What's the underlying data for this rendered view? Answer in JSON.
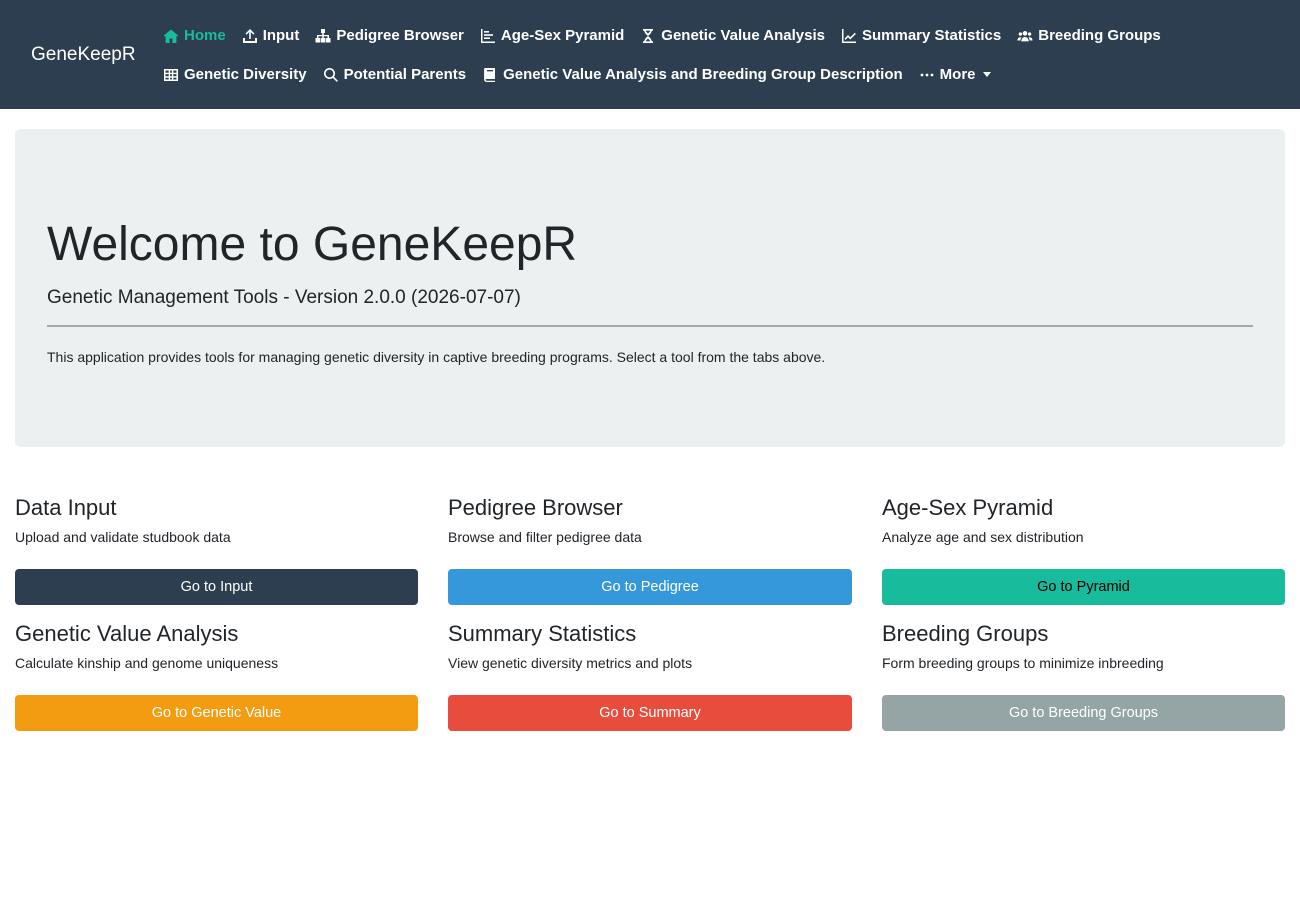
{
  "app": {
    "brand": "GeneKeepR"
  },
  "nav": {
    "items": [
      {
        "label": "Home",
        "icon": "home-icon"
      },
      {
        "label": "Input",
        "icon": "upload-icon"
      },
      {
        "label": "Pedigree Browser",
        "icon": "sitemap-icon"
      },
      {
        "label": "Age-Sex Pyramid",
        "icon": "bar-chart-icon"
      },
      {
        "label": "Genetic Value Analysis",
        "icon": "dna-icon"
      },
      {
        "label": "Summary Statistics",
        "icon": "line-chart-icon"
      },
      {
        "label": "Breeding Groups",
        "icon": "users-icon"
      },
      {
        "label": "Genetic Diversity",
        "icon": "table-icon"
      },
      {
        "label": "Potential Parents",
        "icon": "search-icon"
      },
      {
        "label": "Genetic Value Analysis and Breeding Group Description",
        "icon": "book-icon"
      },
      {
        "label": "More",
        "icon": "ellipsis-icon"
      }
    ],
    "active": "Home"
  },
  "hero": {
    "title": "Welcome to GeneKeepR",
    "subtitle": "Genetic Management Tools - Version 2.0.0 (2026-07-07)",
    "description": "This application provides tools for managing genetic diversity in captive breeding programs. Select a tool from the tabs above."
  },
  "cards": [
    {
      "title": "Data Input",
      "description": "Upload and validate studbook data",
      "button": "Go to Input",
      "color": "#2c3e50"
    },
    {
      "title": "Pedigree Browser",
      "description": "Browse and filter pedigree data",
      "button": "Go to Pedigree",
      "color": "#3498db"
    },
    {
      "title": "Age-Sex Pyramid",
      "description": "Analyze age and sex distribution",
      "button": "Go to Pyramid",
      "color": "#18bc9c"
    },
    {
      "title": "Genetic Value Analysis",
      "description": "Calculate kinship and genome uniqueness",
      "button": "Go to Genetic Value",
      "color": "#f39c12"
    },
    {
      "title": "Summary Statistics",
      "description": "View genetic diversity metrics and plots",
      "button": "Go to Summary",
      "color": "#e74c3c"
    },
    {
      "title": "Breeding Groups",
      "description": "Form breeding groups to minimize inbreeding",
      "button": "Go to Breeding Groups",
      "color": "#95a5a6"
    }
  ],
  "colors": {
    "navbar": "#2c3e50",
    "active": "#18bc9c",
    "hero_bg": "#ecf0f1"
  }
}
